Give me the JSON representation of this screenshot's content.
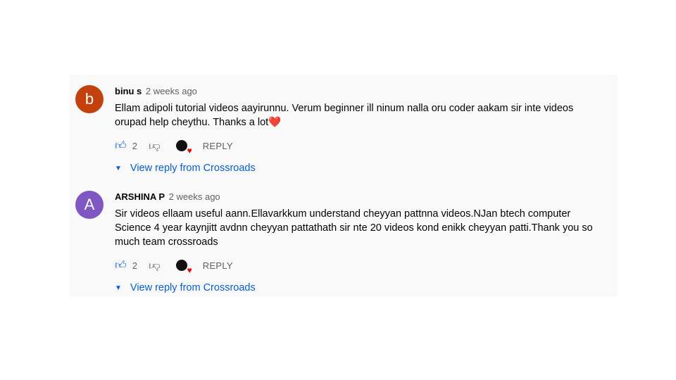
{
  "comments": [
    {
      "avatar_letter": "b",
      "avatar_color": "#c2410c",
      "author": "binu s",
      "time": "2 weeks ago",
      "text": "Ellam adipoli tutorial videos aayirunnu. Verum beginner ill ninum nalla oru coder aakam sir inte videos orupad help cheythu. Thanks a lot❤️",
      "likes": "2",
      "reply_label": "REPLY",
      "view_replies": "View reply from Crossroads"
    },
    {
      "avatar_letter": "A",
      "avatar_color": "#7e57c2",
      "author": "ARSHINA P",
      "time": "2 weeks ago",
      "text": "Sir videos ellaam useful aann.Ellavarkkum understand cheyyan pattnna videos.NJan btech computer Science 4 year kaynjitt avdnn cheyyan pattathath sir nte 20 videos kond enikk cheyyan patti.Thank you so much team crossroads",
      "likes": "2",
      "reply_label": "REPLY",
      "view_replies": "View reply from Crossroads"
    }
  ]
}
